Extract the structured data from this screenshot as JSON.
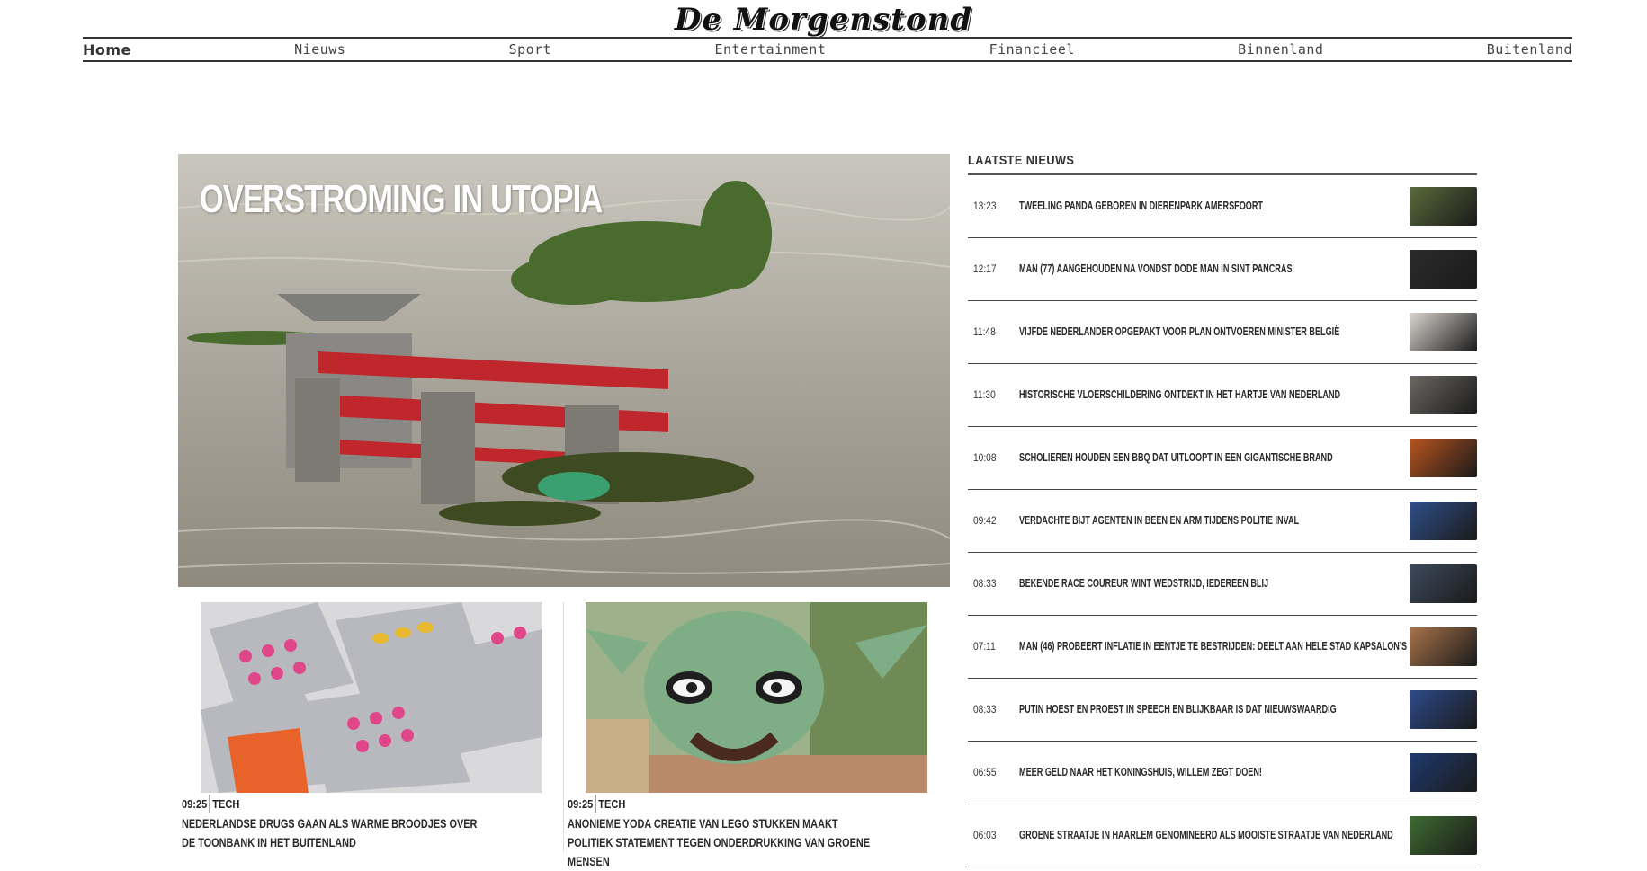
{
  "site": {
    "logo_text": "De Morgenstond"
  },
  "nav": {
    "items": [
      {
        "label": "Home",
        "active": true
      },
      {
        "label": "Nieuws",
        "active": false
      },
      {
        "label": "Sport",
        "active": false
      },
      {
        "label": "Entertainment",
        "active": false
      },
      {
        "label": "Financieel",
        "active": false
      },
      {
        "label": "Binnenland",
        "active": false
      },
      {
        "label": "Buitenland",
        "active": false
      }
    ]
  },
  "hero": {
    "title": "OVERSTROMING IN UTOPIA",
    "image": "flooded-bench-photo"
  },
  "cards": [
    {
      "time": "09:25",
      "category": "TECH",
      "title": "Nederlandse drugs gaan als warme broodjes over de toonbank in het buitenland",
      "image": "pill-blister-packs-photo"
    },
    {
      "time": "09:25",
      "category": "TECH",
      "title": "Anonieme Yoda creatie van lego stukken maakt politiek statement tegen onderdrukking van groene mensen",
      "image": "lego-yoda-photo"
    }
  ],
  "sidebar": {
    "heading": "LAATSTE NIEUWS",
    "items": [
      {
        "time": "13:23",
        "title": "Tweeling panda geboren in dierenpark Amersfoort",
        "thumb": "panda-thumb",
        "thumb_color": "#5a6b3c"
      },
      {
        "time": "12:17",
        "title": "Man (77) aangehouden na vondst dode man in Sint Pancras",
        "thumb": "dark-alley-thumb",
        "thumb_color": "#2b2b2b"
      },
      {
        "time": "11:48",
        "title": "Vijfde Nederlander opgepakt voor plan ontvoeren minister België",
        "thumb": "handcuffs-thumb",
        "thumb_color": "#d9d4cf"
      },
      {
        "time": "11:30",
        "title": "Historische vloerschildering ontdekt in het hartje van Nederland",
        "thumb": "floor-sign-thumb",
        "thumb_color": "#6b6863"
      },
      {
        "time": "10:08",
        "title": "Scholieren houden een BBQ dat uitloopt in een gigantische brand",
        "thumb": "fire-thumb",
        "thumb_color": "#b8541e"
      },
      {
        "time": "09:42",
        "title": "Verdachte bijt agenten in been en arm tijdens politie inval",
        "thumb": "police-thumb",
        "thumb_color": "#2f4f8a"
      },
      {
        "time": "08:33",
        "title": "Bekende race coureur wint wedstrijd, iedereen blij",
        "thumb": "race-car-thumb",
        "thumb_color": "#3c4a5c"
      },
      {
        "time": "07:11",
        "title": "Man (46) probeert inflatie in eentje te bestrijden: deelt aan hele stad kapsalon's uit",
        "thumb": "kapsalon-thumb",
        "thumb_color": "#a8734a"
      },
      {
        "time": "08:33",
        "title": "Putin hoest en proest in speech en blijkbaar is dat nieuwswaardig",
        "thumb": "putin-speech-thumb",
        "thumb_color": "#2d4a8a"
      },
      {
        "time": "06:55",
        "title": "Meer geld naar het koningshuis, Willem zegt doen!",
        "thumb": "king-thumb",
        "thumb_color": "#1e3a6e"
      },
      {
        "time": "06:03",
        "title": "Groene straatje in Haarlem genomineerd als mooiste straatje van Nederland",
        "thumb": "green-street-thumb",
        "thumb_color": "#3e6b32"
      }
    ]
  }
}
